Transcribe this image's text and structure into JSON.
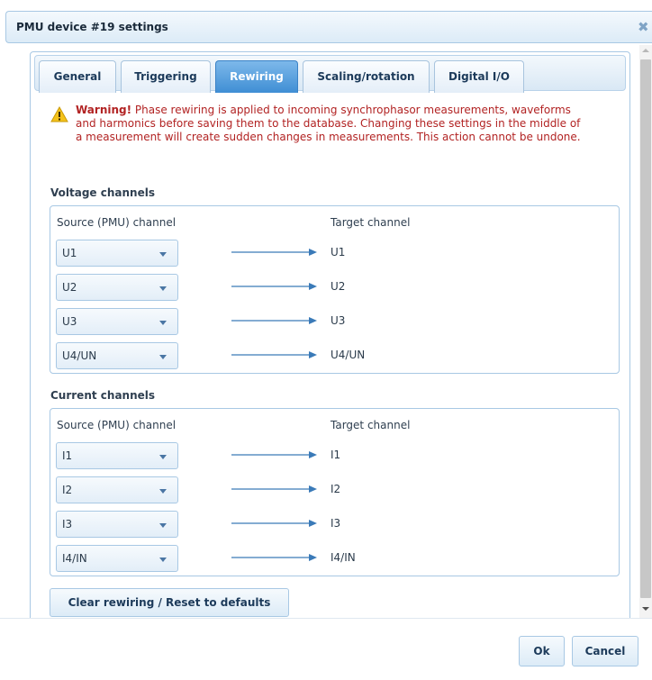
{
  "dialog": {
    "title": "PMU device #19 settings",
    "close_symbol": "✖"
  },
  "tabs": [
    {
      "label": "General",
      "active": false
    },
    {
      "label": "Triggering",
      "active": false
    },
    {
      "label": "Rewiring",
      "active": true
    },
    {
      "label": "Scaling/rotation",
      "active": false
    },
    {
      "label": "Digital I/O",
      "active": false
    }
  ],
  "warning": {
    "icon": "warning-triangle-icon",
    "prefix": "Warning!",
    "text": " Phase rewiring is applied to incoming synchrophasor measurements, waveforms and harmonics before saving them to the database. Changing these settings in the middle of a measurement will create sudden changes in measurements. This action cannot be undone."
  },
  "voltage": {
    "title": "Voltage channels",
    "source_header": "Source (PMU) channel",
    "target_header": "Target channel",
    "rows": [
      {
        "source": "U1",
        "target": "U1"
      },
      {
        "source": "U2",
        "target": "U2"
      },
      {
        "source": "U3",
        "target": "U3"
      },
      {
        "source": "U4/UN",
        "target": "U4/UN"
      }
    ]
  },
  "current": {
    "title": "Current channels",
    "source_header": "Source (PMU) channel",
    "target_header": "Target channel",
    "rows": [
      {
        "source": "I1",
        "target": "I1"
      },
      {
        "source": "I2",
        "target": "I2"
      },
      {
        "source": "I3",
        "target": "I3"
      },
      {
        "source": "I4/IN",
        "target": "I4/IN"
      }
    ]
  },
  "reset_button": "Clear rewiring / Reset to defaults",
  "footer": {
    "ok": "Ok",
    "cancel": "Cancel"
  },
  "colors": {
    "accent": "#3f8ed4",
    "warning_text": "#b22323",
    "border": "#a8c8e4"
  }
}
